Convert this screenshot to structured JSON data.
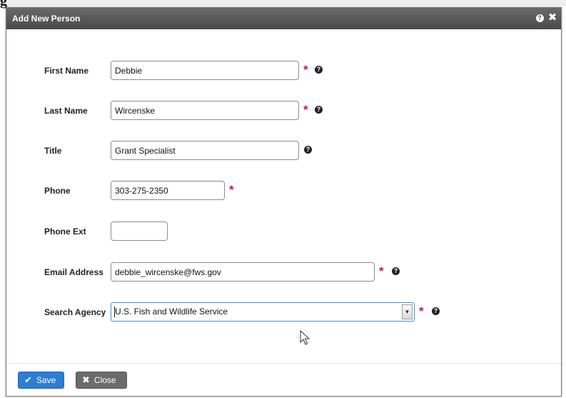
{
  "background": {
    "heading": "g"
  },
  "dialog": {
    "title": "Add New Person",
    "help_icon": "question-circle-icon",
    "close_icon": "close-icon"
  },
  "form": {
    "first_name": {
      "label": "First Name",
      "value": "Debbie",
      "required": true,
      "help": true
    },
    "last_name": {
      "label": "Last Name",
      "value": "Wircenske",
      "required": true,
      "help": true
    },
    "title": {
      "label": "Title",
      "value": "Grant Specialist",
      "required": false,
      "help": true
    },
    "phone": {
      "label": "Phone",
      "value": "303-275-2350",
      "required": true,
      "help": false
    },
    "phone_ext": {
      "label": "Phone Ext",
      "value": "",
      "required": false,
      "help": false
    },
    "email": {
      "label": "Email Address",
      "value": "debbie_wircenske@fws.gov",
      "required": true,
      "help": true
    },
    "agency": {
      "label": "Search Agency",
      "value": "U.S. Fish and Wildlife Service",
      "required": true,
      "help": true
    }
  },
  "symbols": {
    "required": "*",
    "help": "?",
    "close": "✖",
    "check": "✔",
    "dropdown": "▼"
  },
  "buttons": {
    "save": "Save",
    "close": "Close"
  },
  "colors": {
    "titlebar": "#555555",
    "save": "#2d7dd2",
    "close": "#6b6b6b",
    "required": "#c2185b"
  }
}
